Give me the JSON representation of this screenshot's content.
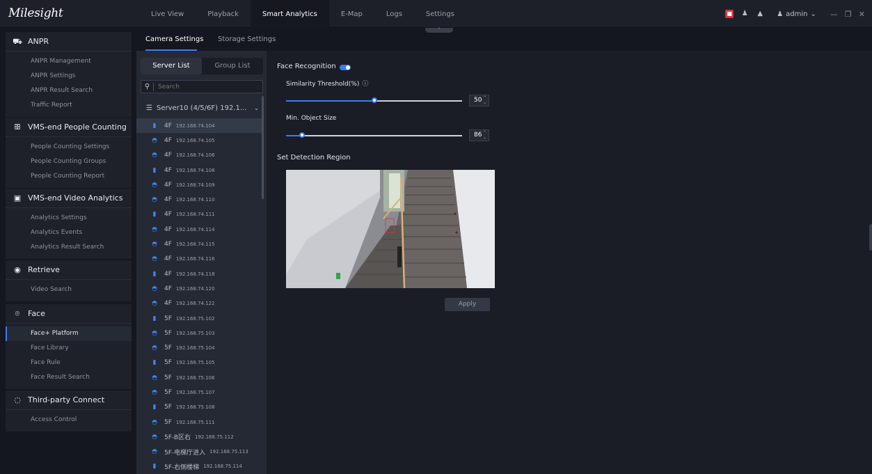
{
  "app": {
    "logo": "Milesight"
  },
  "nav": {
    "items": [
      "Live View",
      "Playback",
      "Smart Analytics",
      "E-Map",
      "Logs",
      "Settings"
    ],
    "active": "Smart Analytics"
  },
  "topbar": {
    "user": "admin",
    "icons": [
      "alarm-icon",
      "user-manage-icon",
      "bell-icon",
      "user-icon",
      "minimize-icon",
      "restore-icon",
      "close-icon"
    ],
    "accent": "#3d7bf5",
    "alarm_color": "#e0303f"
  },
  "sidebar": {
    "groups": [
      {
        "title": "ANPR",
        "icon": "car-icon",
        "items": [
          "ANPR Management",
          "ANPR Settings",
          "ANPR Result Search",
          "Traffic Report"
        ]
      },
      {
        "title": "VMS-end People Counting",
        "icon": "people-icon",
        "items": [
          "People Counting Settings",
          "People Counting Groups",
          "People Counting Report"
        ]
      },
      {
        "title": "VMS-end Video Analytics",
        "icon": "ai-icon",
        "items": [
          "Analytics Settings",
          "Analytics Events",
          "Analytics Result Search"
        ]
      },
      {
        "title": "Retrieve",
        "icon": "retrieve-icon",
        "items": [
          "Video Search"
        ]
      },
      {
        "title": "Face",
        "icon": "face-icon",
        "items": [
          "Face+ Platform",
          "Face Library",
          "Face Rule",
          "Face Result Search"
        ],
        "active_item": "Face+ Platform"
      },
      {
        "title": "Third-party Connect",
        "icon": "connect-icon",
        "items": [
          "Access Control"
        ]
      }
    ]
  },
  "tabs": {
    "camera": "Camera Settings",
    "storage": "Storage Settings"
  },
  "list": {
    "seg": {
      "server": "Server List",
      "group": "Group List"
    },
    "search_placeholder": "Search",
    "server": "Server10 (4/5/6F) 192.1...",
    "devices": [
      {
        "name": "4F",
        "ip": "192.168.74.104",
        "type": "bullet"
      },
      {
        "name": "4F",
        "ip": "192.168.74.105",
        "type": "dome"
      },
      {
        "name": "4F",
        "ip": "192.168.74.106",
        "type": "dome"
      },
      {
        "name": "4F",
        "ip": "192.168.74.108",
        "type": "bullet"
      },
      {
        "name": "4F",
        "ip": "192.168.74.109",
        "type": "dome"
      },
      {
        "name": "4F",
        "ip": "192.168.74.110",
        "type": "dome"
      },
      {
        "name": "4F",
        "ip": "192.168.74.111",
        "type": "bullet"
      },
      {
        "name": "4F",
        "ip": "192.168.74.114",
        "type": "dome"
      },
      {
        "name": "4F",
        "ip": "192.168.74.115",
        "type": "dome"
      },
      {
        "name": "4F",
        "ip": "192.168.74.116",
        "type": "dome"
      },
      {
        "name": "4F",
        "ip": "192.168.74.118",
        "type": "bullet"
      },
      {
        "name": "4F",
        "ip": "192.168.74.120",
        "type": "dome"
      },
      {
        "name": "4F",
        "ip": "192.168.74.122",
        "type": "dome"
      },
      {
        "name": "5F",
        "ip": "192.168.75.102",
        "type": "bullet"
      },
      {
        "name": "5F",
        "ip": "192.168.75.103",
        "type": "dome"
      },
      {
        "name": "5F",
        "ip": "192.168.75.104",
        "type": "dome"
      },
      {
        "name": "5F",
        "ip": "192.168.75.105",
        "type": "bullet"
      },
      {
        "name": "5F",
        "ip": "192.168.75.106",
        "type": "dome"
      },
      {
        "name": "5F",
        "ip": "192.168.75.107",
        "type": "dome"
      },
      {
        "name": "5F",
        "ip": "192.168.75.108",
        "type": "bullet"
      },
      {
        "name": "5F",
        "ip": "192.168.75.111",
        "type": "dome"
      },
      {
        "name": "5F-B区右",
        "ip": "192.168.75.112",
        "type": "dome"
      },
      {
        "name": "5F-电梯厅进入",
        "ip": "192.168.75.113",
        "type": "dome"
      },
      {
        "name": "5F-右侧楼梯",
        "ip": "192.168.75.114",
        "type": "bullet"
      }
    ]
  },
  "face": {
    "recognition_label": "Face Recognition",
    "recognition_on": true,
    "threshold_label": "Similarity Threshold(%)",
    "threshold_value": "50",
    "threshold_level": 0.5,
    "min_size_label": "Min. Object Size",
    "min_size_value": "86",
    "min_size_level": 0.09,
    "region_label": "Set Detection Region",
    "apply_label": "Apply"
  }
}
